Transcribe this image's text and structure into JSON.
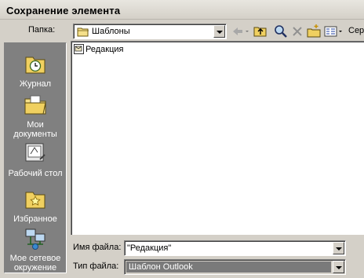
{
  "window": {
    "title": "Сохранение элемента"
  },
  "toolbar": {
    "folder_label": "Папка:",
    "folder_value": "Шаблоны",
    "service_label": "Серв"
  },
  "places": [
    {
      "label": "Журнал",
      "icon": "history-icon"
    },
    {
      "label": "Мои документы",
      "icon": "my-documents-icon"
    },
    {
      "label": "Рабочий стол",
      "icon": "desktop-icon"
    },
    {
      "label": "Избранное",
      "icon": "favorites-icon"
    },
    {
      "label": "Мое сетевое окружение",
      "icon": "network-icon"
    }
  ],
  "files": [
    {
      "name": "Редакция",
      "icon": "outlook-template-icon"
    }
  ],
  "form": {
    "filename_label": "Имя файла:",
    "filename_value": "\"Редакция\"",
    "filetype_label": "Тип файла:",
    "filetype_value": "Шаблон Outlook"
  },
  "colors": {
    "dialog_bg": "#d4d0c8",
    "places_bg": "#808080",
    "selection_bg": "#7a7a7a"
  }
}
